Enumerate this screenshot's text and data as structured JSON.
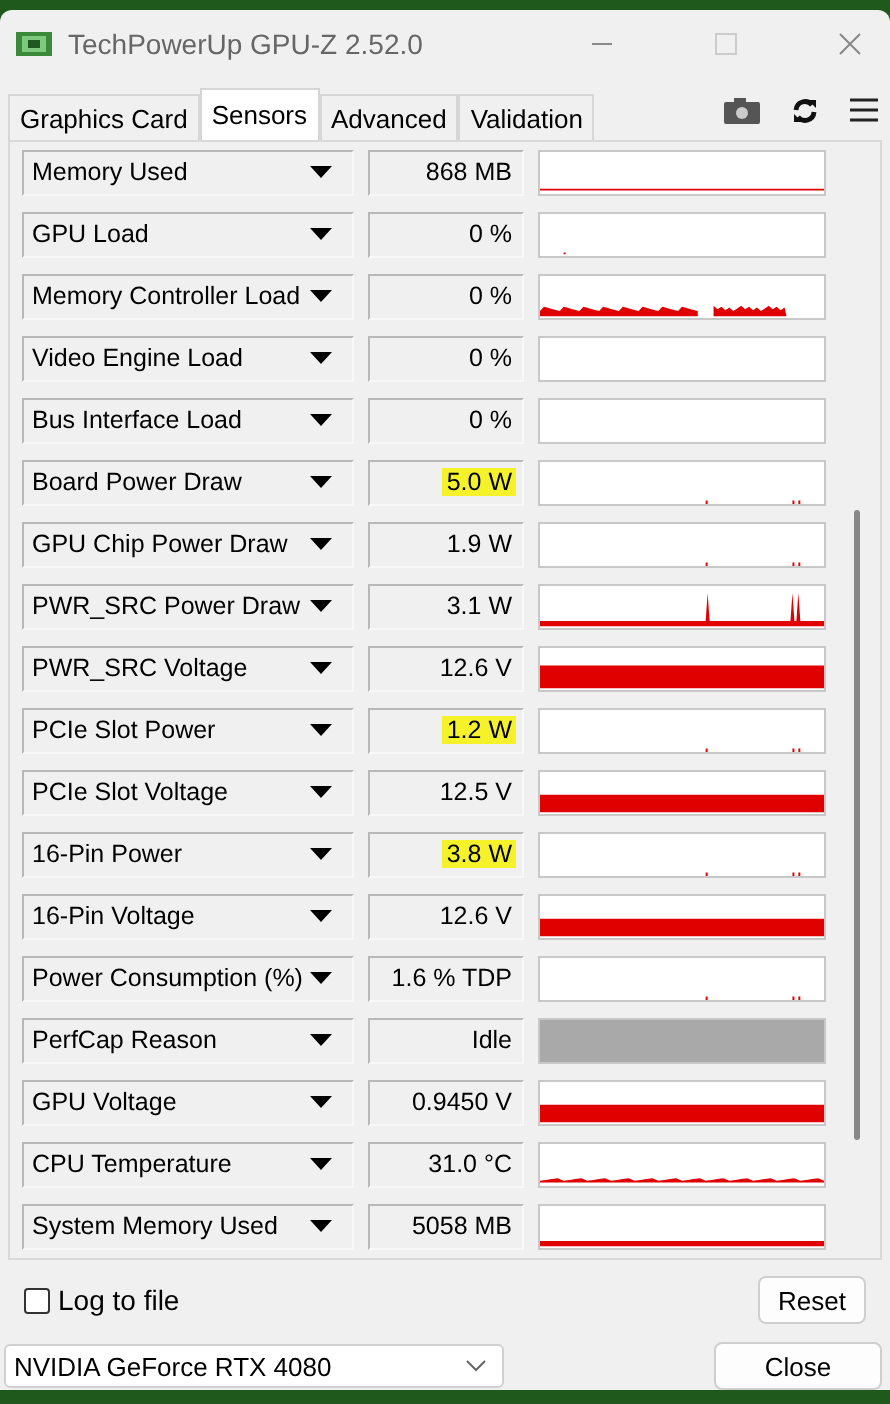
{
  "window": {
    "title": "TechPowerUp GPU-Z 2.52.0"
  },
  "tabs": [
    {
      "label": "Graphics Card",
      "selected": false
    },
    {
      "label": "Sensors",
      "selected": true
    },
    {
      "label": "Advanced",
      "selected": false
    },
    {
      "label": "Validation",
      "selected": false
    }
  ],
  "sensors": [
    {
      "name": "Memory Used",
      "value": "868 MB",
      "highlighted": false,
      "kind": "line"
    },
    {
      "name": "GPU Load",
      "value": "0 %",
      "highlighted": false,
      "kind": "dot"
    },
    {
      "name": "Memory Controller Load",
      "value": "0 %",
      "highlighted": false,
      "kind": "noise"
    },
    {
      "name": "Video Engine Load",
      "value": "0 %",
      "highlighted": false,
      "kind": "empty"
    },
    {
      "name": "Bus Interface Load",
      "value": "0 %",
      "highlighted": false,
      "kind": "empty"
    },
    {
      "name": "Board Power Draw",
      "value": "5.0 W",
      "highlighted": true,
      "kind": "ticks"
    },
    {
      "name": "GPU Chip Power Draw",
      "value": "1.9 W",
      "highlighted": false,
      "kind": "ticks"
    },
    {
      "name": "PWR_SRC Power Draw",
      "value": "3.1 W",
      "highlighted": false,
      "kind": "spikes"
    },
    {
      "name": "PWR_SRC Voltage",
      "value": "12.6 V",
      "highlighted": false,
      "kind": "full"
    },
    {
      "name": "PCIe Slot Power",
      "value": "1.2 W",
      "highlighted": true,
      "kind": "ticks"
    },
    {
      "name": "PCIe Slot Voltage",
      "value": "12.5 V",
      "highlighted": false,
      "kind": "band"
    },
    {
      "name": "16-Pin Power",
      "value": "3.8 W",
      "highlighted": true,
      "kind": "ticks"
    },
    {
      "name": "16-Pin Voltage",
      "value": "12.6 V",
      "highlighted": false,
      "kind": "band"
    },
    {
      "name": "Power Consumption (%)",
      "value": "1.6 % TDP",
      "highlighted": false,
      "kind": "ticks"
    },
    {
      "name": "PerfCap Reason",
      "value": "Idle",
      "highlighted": false,
      "kind": "gray"
    },
    {
      "name": "GPU Voltage",
      "value": "0.9450 V",
      "highlighted": false,
      "kind": "band"
    },
    {
      "name": "CPU Temperature",
      "value": "31.0 °C",
      "highlighted": false,
      "kind": "lownoise"
    },
    {
      "name": "System Memory Used",
      "value": "5058 MB",
      "highlighted": false,
      "kind": "thick"
    }
  ],
  "log_to_file": {
    "label": "Log to file",
    "checked": false
  },
  "reset_button": "Reset",
  "gpu_select": {
    "value": "NVIDIA GeForce RTX 4080"
  },
  "close_button": "Close"
}
